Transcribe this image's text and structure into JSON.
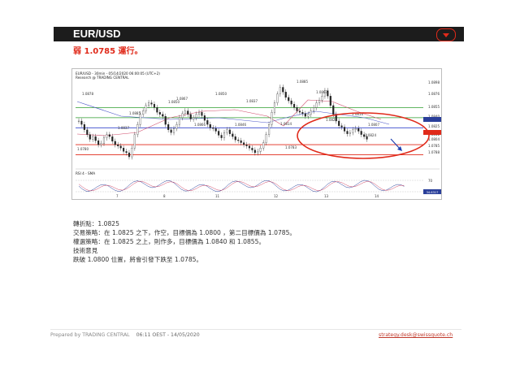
{
  "header": {
    "title": "EUR/USD",
    "menu_icon": "chevron-down-icon"
  },
  "subtitle": "弱   1.0785 運行。",
  "chart": {
    "info_line1": "EUR/USD - 30min - 05/14/2020 06:00:05 (UTC+2)",
    "info_line2": "Research @ TRADING CENTRAL",
    "price_labels": [
      "1.0898",
      "1.0876",
      "1.0855",
      "1.0840",
      "1.0832",
      "1.0825",
      "1.0814",
      "1.0811",
      "1.0804",
      "1.0785",
      "1.0788"
    ],
    "swing_labels": [
      "1.0878",
      "1.0885",
      "1.0867",
      "1.0866",
      "1.0850",
      "1.0846",
      "1.0837",
      "1.0810",
      "1.0819",
      "1.0820",
      "1.0814",
      "1.0807",
      "1.0799",
      "1.0783",
      "1.0780",
      "1.0828",
      "1.0816",
      "1.0824",
      "1.0807"
    ],
    "rsi_label": "RSI 4 - SMA",
    "rsi_levels": [
      "70",
      "30"
    ],
    "rsi_badges": [
      "34.6317",
      "35.0367"
    ],
    "x_ticks": [
      "7",
      "8",
      "11",
      "12",
      "13",
      "14"
    ],
    "colors": {
      "support": "#e02a1a",
      "resist": "#2e9e2e",
      "pivot": "#3344cc",
      "ellipse": "#e02a1a",
      "arrow": "#1f3fb0"
    }
  },
  "analysis": {
    "pivot": "轉折點：1.0825",
    "strategy": "交易策略：在 1.0825 之下，作空，目標價為 1.0800 ，第二目標價為 1.0785。",
    "alternative": "權選策略：在 1.0825 之上，則作多，目標價為 1.0840 和 1.0855。",
    "comment_title": "技術意見",
    "comment": "跌破 1.0800 位置，將會引發下跌至 1.0785。"
  },
  "footer": {
    "prepared": "Prepared by TRADING CENTRAL",
    "time": "06:11 OEST - 14/05/2020",
    "email": "strategy.desk@swissquote.ch"
  }
}
